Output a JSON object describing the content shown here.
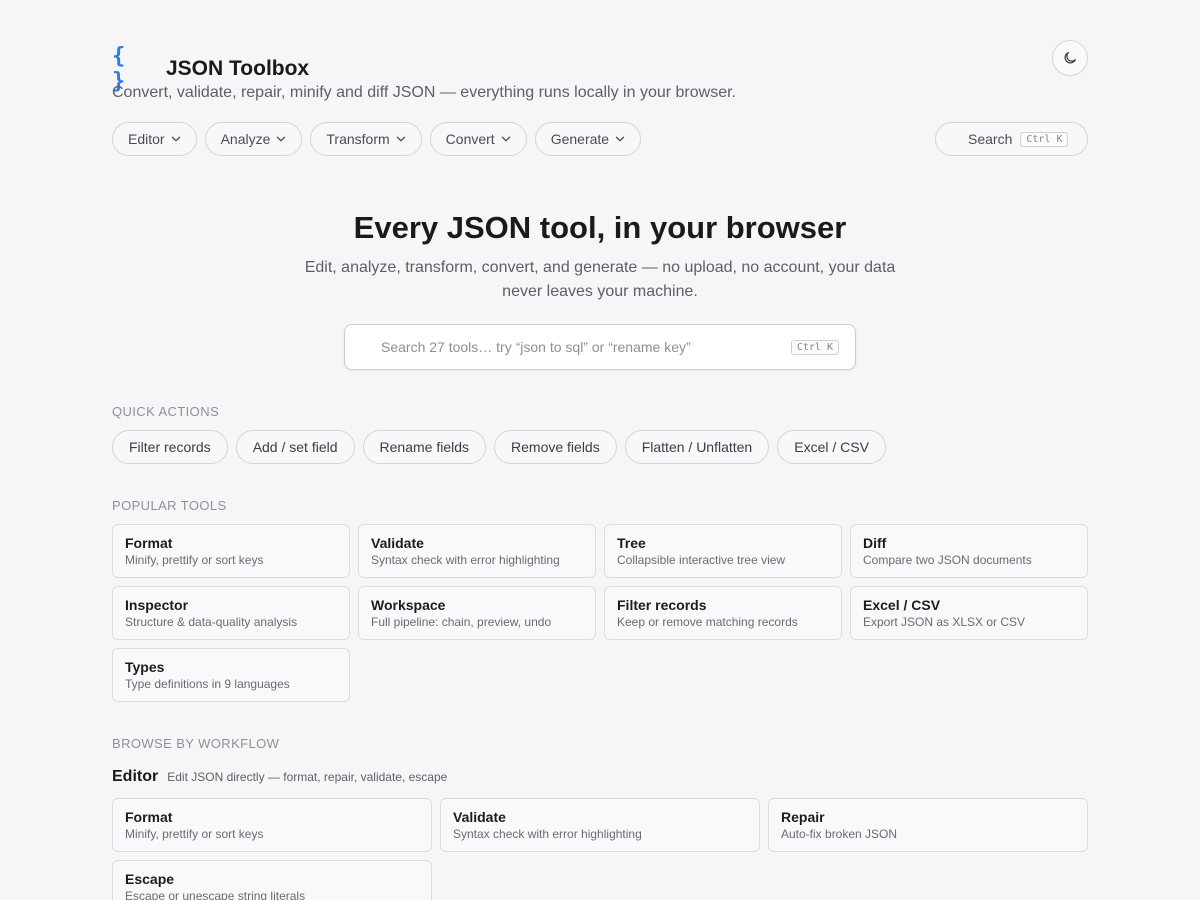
{
  "header": {
    "logo": "{ }",
    "title": "JSON Toolbox",
    "tagline": "Convert, validate, repair, minify and diff JSON — everything runs locally in your browser."
  },
  "nav": {
    "items": [
      "Editor",
      "Analyze",
      "Transform",
      "Convert",
      "Generate"
    ],
    "search_label": "Search",
    "search_shortcut": "Ctrl K"
  },
  "hero": {
    "title": "Every JSON tool, in your browser",
    "subtitle": "Edit, analyze, transform, convert, and generate — no upload, no account, your data never leaves your machine.",
    "search_placeholder": "Search 27 tools… try “json to sql” or “rename key”",
    "search_shortcut": "Ctrl K"
  },
  "quick_actions": {
    "label": "QUICK ACTIONS",
    "items": [
      "Filter records",
      "Add / set field",
      "Rename fields",
      "Remove fields",
      "Flatten / Unflatten",
      "Excel / CSV"
    ]
  },
  "popular": {
    "label": "POPULAR TOOLS",
    "tools": [
      {
        "title": "Format",
        "desc": "Minify, prettify or sort keys"
      },
      {
        "title": "Validate",
        "desc": "Syntax check with error highlighting"
      },
      {
        "title": "Tree",
        "desc": "Collapsible interactive tree view"
      },
      {
        "title": "Diff",
        "desc": "Compare two JSON documents"
      },
      {
        "title": "Inspector",
        "desc": "Structure & data-quality analysis"
      },
      {
        "title": "Workspace",
        "desc": "Full pipeline: chain, preview, undo"
      },
      {
        "title": "Filter records",
        "desc": "Keep or remove matching records"
      },
      {
        "title": "Excel / CSV",
        "desc": "Export JSON as XLSX or CSV"
      },
      {
        "title": "Types",
        "desc": "Type definitions in 9 languages"
      }
    ]
  },
  "workflow": {
    "label": "BROWSE BY WORKFLOW",
    "editor": {
      "title": "Editor",
      "desc": "Edit JSON directly — format, repair, validate, escape",
      "tools": [
        {
          "title": "Format",
          "desc": "Minify, prettify or sort keys"
        },
        {
          "title": "Validate",
          "desc": "Syntax check with error highlighting"
        },
        {
          "title": "Repair",
          "desc": "Auto-fix broken JSON"
        },
        {
          "title": "Escape",
          "desc": "Escape or unescape string literals"
        }
      ]
    }
  },
  "colors": {
    "accent": "#2f7be5",
    "background": "#f6f6f8"
  }
}
